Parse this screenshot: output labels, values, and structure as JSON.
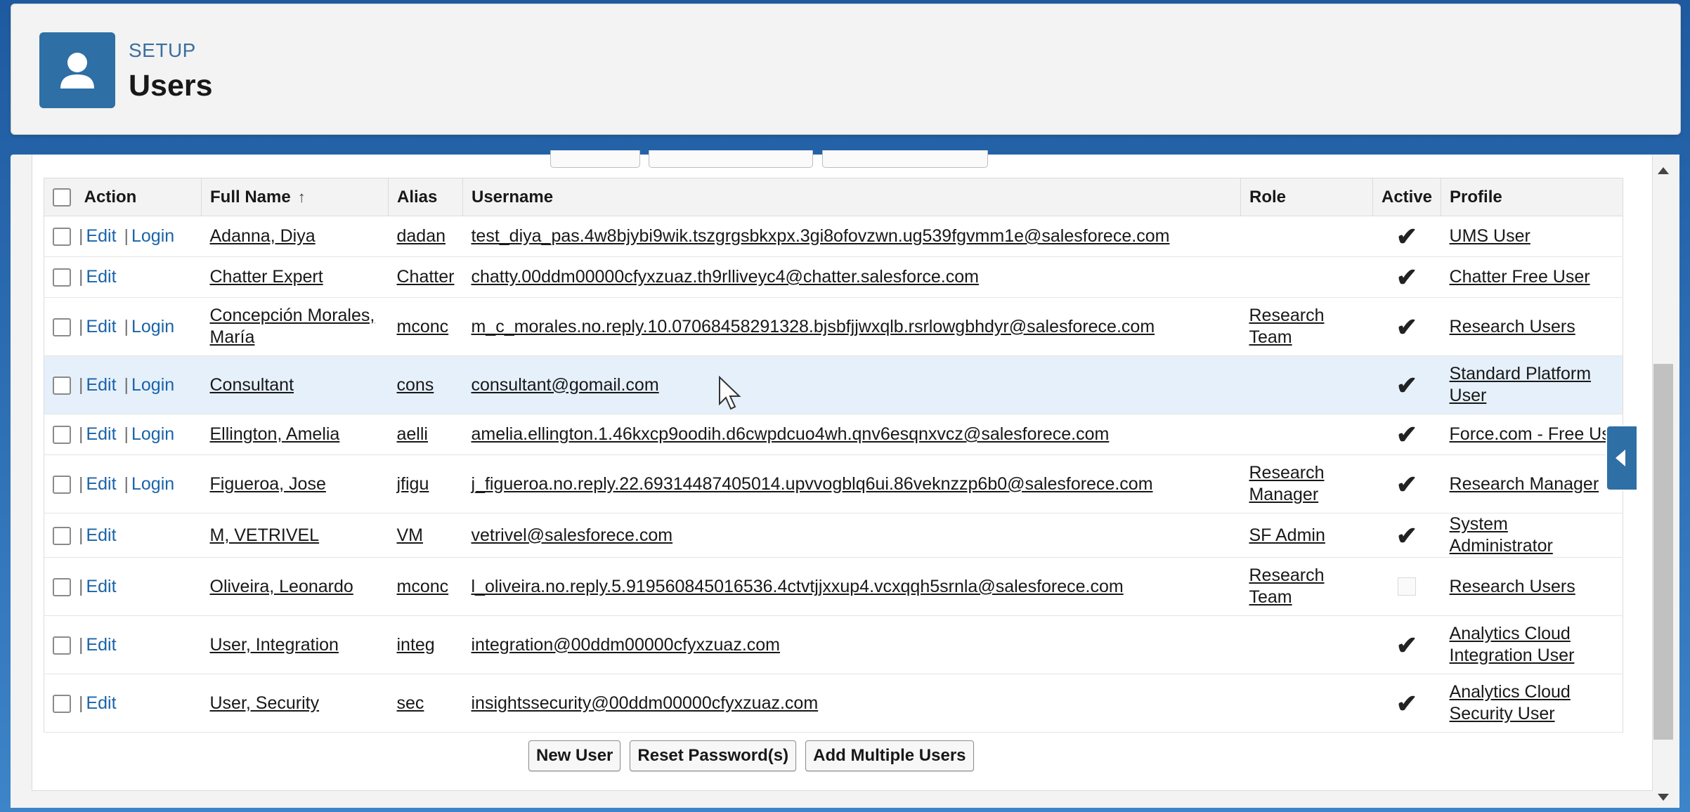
{
  "header": {
    "setup_label": "SETUP",
    "title": "Users"
  },
  "table": {
    "columns": {
      "action": "Action",
      "full_name": "Full Name",
      "alias": "Alias",
      "username": "Username",
      "role": "Role",
      "active": "Active",
      "profile": "Profile"
    },
    "action_labels": {
      "edit": "Edit",
      "login": "Login",
      "sep": "|"
    },
    "rows": [
      {
        "full_name": "Adanna, Diya",
        "alias": "dadan",
        "username": "test_diya_pas.4w8bjybi9wik.tszgrgsbkxpx.3gi8ofovzwn.ug539fgvmm1e@salesforece.com",
        "role": "",
        "active": true,
        "profile": "UMS User",
        "login": true
      },
      {
        "full_name": "Chatter Expert",
        "alias": "Chatter",
        "username": "chatty.00ddm00000cfyxzuaz.th9rlliveyc4@chatter.salesforce.com",
        "role": "",
        "active": true,
        "profile": "Chatter Free User",
        "login": false
      },
      {
        "full_name": "Concepción Morales, María",
        "alias": "mconc",
        "username": "m_c_morales.no.reply.10.07068458291328.bjsbfjjwxqlb.rsrlowgbhdyr@salesforece.com",
        "role": "Research Team",
        "active": true,
        "profile": "Research Users",
        "login": true
      },
      {
        "full_name": "Consultant",
        "alias": "cons",
        "username": "consultant@gomail.com",
        "role": "",
        "active": true,
        "profile": "Standard Platform User",
        "login": true
      },
      {
        "full_name": "Ellington, Amelia",
        "alias": "aelli",
        "username": "amelia.ellington.1.46kxcp9oodih.d6cwpdcuo4wh.qnv6esqnxvcz@salesforece.com",
        "role": "",
        "active": true,
        "profile": "Force.com - Free Us",
        "login": true
      },
      {
        "full_name": "Figueroa, Jose",
        "alias": "jfigu",
        "username": "j_figueroa.no.reply.22.69314487405014.upvvogblq6ui.86veknzzp6b0@salesforece.com",
        "role": "Research Manager",
        "active": true,
        "profile": "Research Manager",
        "login": true
      },
      {
        "full_name": "M, VETRIVEL",
        "alias": "VM",
        "username": "vetrivel@salesforece.com",
        "role": "SF Admin",
        "active": true,
        "profile": "System Administrator",
        "login": false
      },
      {
        "full_name": "Oliveira, Leonardo",
        "alias": "mconc",
        "username": "l_oliveira.no.reply.5.919560845016536.4ctvtjjxxup4.vcxqqh5srnla@salesforece.com",
        "role": "Research Team",
        "active": false,
        "profile": "Research Users",
        "login": false
      },
      {
        "full_name": "User, Integration",
        "alias": "integ",
        "username": "integration@00ddm00000cfyxzuaz.com",
        "role": "",
        "active": true,
        "profile": "Analytics Cloud Integration User",
        "login": false
      },
      {
        "full_name": "User, Security",
        "alias": "sec",
        "username": "insightssecurity@00ddm00000cfyxzuaz.com",
        "role": "",
        "active": true,
        "profile": "Analytics Cloud Security User",
        "login": false
      }
    ]
  },
  "buttons": {
    "new_user": "New User",
    "reset_password": "Reset Password(s)",
    "add_multiple": "Add Multiple Users"
  },
  "colors": {
    "accent": "#2e6fa5",
    "link": "#1a63a8",
    "hover_row": "#e5f0fb"
  },
  "icons": {
    "header": "user-icon",
    "sort": "sort-ascending-icon",
    "active": "checkmark-icon",
    "side_tab": "collapse-left-icon"
  }
}
